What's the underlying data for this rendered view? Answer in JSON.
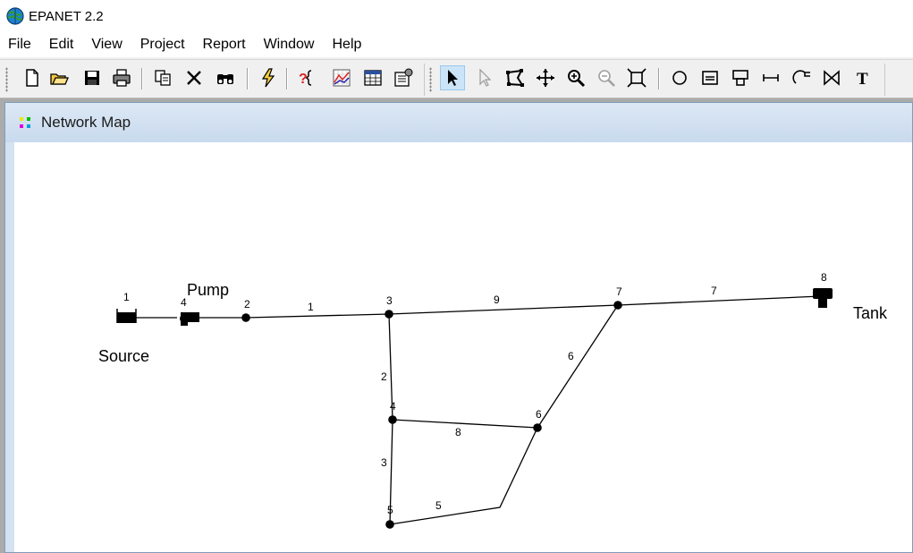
{
  "app": {
    "title": "EPANET 2.2"
  },
  "menu": [
    "File",
    "Edit",
    "View",
    "Project",
    "Report",
    "Window",
    "Help"
  ],
  "window": {
    "title": "Network Map"
  },
  "map": {
    "labels": {
      "source": "Source",
      "pump": "Pump",
      "tank": "Tank"
    },
    "node_ids": [
      "1",
      "2",
      "3",
      "4",
      "5",
      "6",
      "7",
      "8"
    ],
    "link_ids": [
      "1",
      "2",
      "3",
      "4",
      "5",
      "6",
      "7",
      "8",
      "9"
    ]
  }
}
